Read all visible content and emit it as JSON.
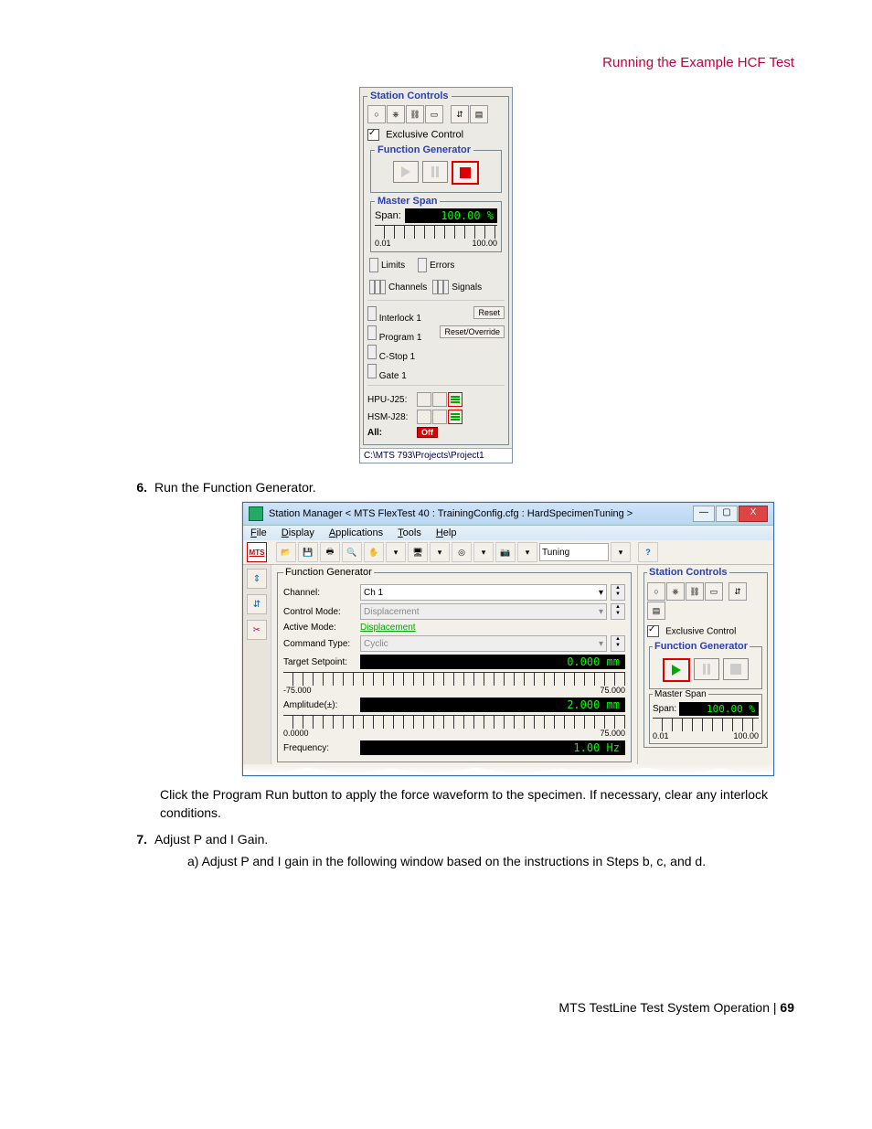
{
  "header": {
    "title": "Running the Example HCF Test"
  },
  "sc1": {
    "legend": "Station Controls",
    "exclusive": "Exclusive Control",
    "fg_legend": "Function Generator",
    "master_span_legend": "Master Span",
    "span_label": "Span:",
    "span_value": "100.00 %",
    "ruler_min": "0.01",
    "ruler_max": "100.00",
    "limits": "Limits",
    "errors": "Errors",
    "channels": "Channels",
    "signals": "Signals",
    "interlock1": "Interlock 1",
    "reset": "Reset",
    "program1": "Program 1",
    "reset_override": "Reset/Override",
    "cstop1": "C-Stop 1",
    "gate1": "Gate 1",
    "hpu": "HPU-J25:",
    "hsm": "HSM-J28:",
    "all": "All:",
    "off": "Off",
    "path": "C:\\MTS 793\\Projects\\Project1"
  },
  "step6": {
    "num": "6.",
    "text": "Run the Function Generator."
  },
  "sm": {
    "title": "Station Manager < MTS FlexTest 40 : TrainingConfig.cfg : HardSpecimenTuning >",
    "menu": {
      "file": "File",
      "display": "Display",
      "applications": "Applications",
      "tools": "Tools",
      "help": "Help"
    },
    "combo_tuning": "Tuning",
    "mts": "MTS",
    "fg_legend": "Function Generator",
    "channel_label": "Channel:",
    "channel_value": "Ch 1",
    "control_mode_label": "Control Mode:",
    "control_mode_value": "Displacement",
    "active_mode_label": "Active Mode:",
    "active_mode_value": "Displacement",
    "command_type_label": "Command Type:",
    "command_type_value": "Cyclic",
    "target_setpoint_label": "Target Setpoint:",
    "target_setpoint_value": "0.000  mm",
    "ts_min": "-75.000",
    "ts_max": "75.000",
    "amplitude_label": "Amplitude(±):",
    "amplitude_value": "2.000  mm",
    "amp_min": "0.0000",
    "amp_max": "75.000",
    "frequency_label": "Frequency:",
    "frequency_value": "1.00  Hz",
    "sc_legend": "Station Controls",
    "sc_exclusive": "Exclusive Control",
    "sc_fg_legend": "Function Generator",
    "sc_ms_legend": "Master Span",
    "sc_span_label": "Span:",
    "sc_span_value": "100.00 %",
    "sc_ruler_min": "0.01",
    "sc_ruler_max": "100.00"
  },
  "para6": "Click the Program Run button to apply the force waveform to the specimen. If necessary, clear any interlock conditions.",
  "step7": {
    "num": "7.",
    "text": "Adjust P and I Gain."
  },
  "step7a": "a)  Adjust P and I gain in the following window based on the instructions in Steps b, c, and d.",
  "footer": {
    "text": "MTS TestLine Test System Operation | ",
    "page": "69"
  }
}
